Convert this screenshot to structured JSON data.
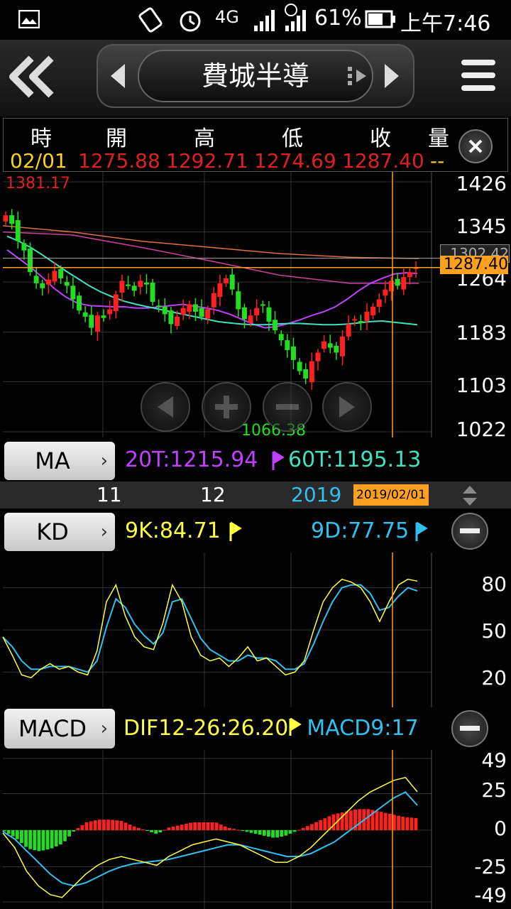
{
  "status_bar": {
    "network": "4G",
    "battery": "61%",
    "time": "上午7:46",
    "sim": "2"
  },
  "header": {
    "title": "費城半導"
  },
  "quote": {
    "headers": [
      "時",
      "開",
      "高",
      "低",
      "收",
      "量"
    ],
    "values": [
      "02/01",
      "1275.88",
      "1292.71",
      "1274.69",
      "1287.40",
      "--"
    ]
  },
  "price_chart": {
    "y_ticks": [
      "1426",
      "1345",
      "1264",
      "1183",
      "1103",
      "1022"
    ],
    "high_label": "1381.17",
    "low_label": "1066.38",
    "ref_label": "1302.42",
    "close_label": "1287.40"
  },
  "ma_bar": {
    "button": "MA",
    "ma20": "20T:1215.94",
    "ma60": "60T:1195.13"
  },
  "date_axis": {
    "labels": [
      "11",
      "12",
      "2019"
    ],
    "cursor_date": "2019/02/01"
  },
  "kd_bar": {
    "button": "KD",
    "k": "9K:84.71",
    "d": "9D:77.75",
    "y_ticks": [
      "80",
      "50",
      "20"
    ]
  },
  "macd_bar": {
    "button": "MACD",
    "dif": "DIF12-26:26.20",
    "macd": "MACD9:17",
    "y_ticks": [
      "49",
      "25",
      "0",
      "-25",
      "-49"
    ]
  },
  "colors": {
    "up": "#ff2020",
    "down": "#22dd22",
    "ma20": "#c040ff",
    "ma60": "#40e0c0",
    "cursor": "#ffa020",
    "k": "#ffff40",
    "d": "#30c0f0"
  },
  "chart_data": [
    {
      "type": "candlestick",
      "title": "費城半導",
      "ylim": [
        1022,
        1426
      ],
      "close_series": [
        1372,
        1358,
        1330,
        1315,
        1280,
        1262,
        1254,
        1268,
        1282,
        1270,
        1258,
        1236,
        1218,
        1208,
        1190,
        1210,
        1206,
        1220,
        1244,
        1266,
        1258,
        1250,
        1266,
        1260,
        1232,
        1224,
        1212,
        1196,
        1208,
        1222,
        1228,
        1216,
        1208,
        1220,
        1246,
        1262,
        1270,
        1252,
        1220,
        1204,
        1210,
        1222,
        1226,
        1200,
        1186,
        1170,
        1154,
        1138,
        1120,
        1108,
        1136,
        1150,
        1168,
        1158,
        1150,
        1176,
        1196,
        1204,
        1198,
        1216,
        1224,
        1236,
        1252,
        1266,
        1258,
        1272,
        1280,
        1287.4
      ],
      "ma_series": [
        {
          "name": "20T",
          "values": [
            1316,
            1302,
            1288,
            1272,
            1254,
            1240,
            1230,
            1226,
            1225,
            1224,
            1224,
            1222,
            1222,
            1224,
            1226,
            1228,
            1225,
            1222,
            1218,
            1212,
            1204,
            1196,
            1190,
            1192,
            1197,
            1203,
            1210,
            1216,
            1224,
            1236,
            1250,
            1262,
            1270,
            1277,
            1279,
            1278
          ]
        },
        {
          "name": "60T",
          "values": [
            1338,
            1330,
            1320,
            1308,
            1295,
            1282,
            1270,
            1258,
            1248,
            1240,
            1233,
            1228,
            1224,
            1220,
            1216,
            1212,
            1208,
            1204,
            1200,
            1198,
            1196,
            1195,
            1195,
            1196,
            1197,
            1197,
            1196,
            1195,
            1195,
            1196,
            1198,
            1200,
            1201,
            1199,
            1197,
            1195
          ]
        }
      ]
    },
    {
      "type": "line",
      "title": "KD",
      "ylim": [
        0,
        100
      ],
      "series": [
        {
          "name": "9K",
          "values": [
            45,
            32,
            18,
            16,
            22,
            26,
            22,
            24,
            20,
            18,
            35,
            70,
            82,
            60,
            45,
            38,
            36,
            55,
            82,
            70,
            45,
            32,
            28,
            30,
            24,
            30,
            38,
            28,
            30,
            24,
            18,
            20,
            28,
            50,
            70,
            80,
            86,
            84,
            80,
            70,
            56,
            70,
            82,
            86,
            84.71
          ]
        },
        {
          "name": "9D",
          "values": [
            45,
            38,
            28,
            22,
            22,
            24,
            24,
            24,
            22,
            20,
            28,
            52,
            72,
            66,
            54,
            46,
            40,
            48,
            70,
            72,
            58,
            44,
            36,
            32,
            28,
            28,
            32,
            30,
            30,
            28,
            22,
            22,
            26,
            40,
            56,
            70,
            80,
            82,
            82,
            76,
            64,
            66,
            74,
            80,
            77.75
          ]
        }
      ]
    },
    {
      "type": "bar",
      "title": "MACD",
      "ylim": [
        -49,
        49
      ],
      "series": [
        {
          "name": "DIF12-26",
          "values": [
            -2,
            -12,
            -28,
            -38,
            -44,
            -46,
            -38,
            -30,
            -24,
            -20,
            -18,
            -20,
            -22,
            -24,
            -18,
            -14,
            -10,
            -8,
            -6,
            -8,
            -10,
            -14,
            -18,
            -22,
            -22,
            -18,
            -12,
            -4,
            4,
            12,
            20,
            26,
            30,
            34,
            36,
            26.2
          ]
        },
        {
          "name": "MACD9",
          "values": [
            -1,
            -6,
            -14,
            -22,
            -30,
            -36,
            -38,
            -36,
            -32,
            -28,
            -25,
            -23,
            -22,
            -21,
            -20,
            -18,
            -16,
            -14,
            -12,
            -10,
            -10,
            -12,
            -14,
            -16,
            -18,
            -18,
            -16,
            -12,
            -8,
            -2,
            4,
            10,
            16,
            22,
            26,
            17
          ]
        }
      ]
    }
  ]
}
